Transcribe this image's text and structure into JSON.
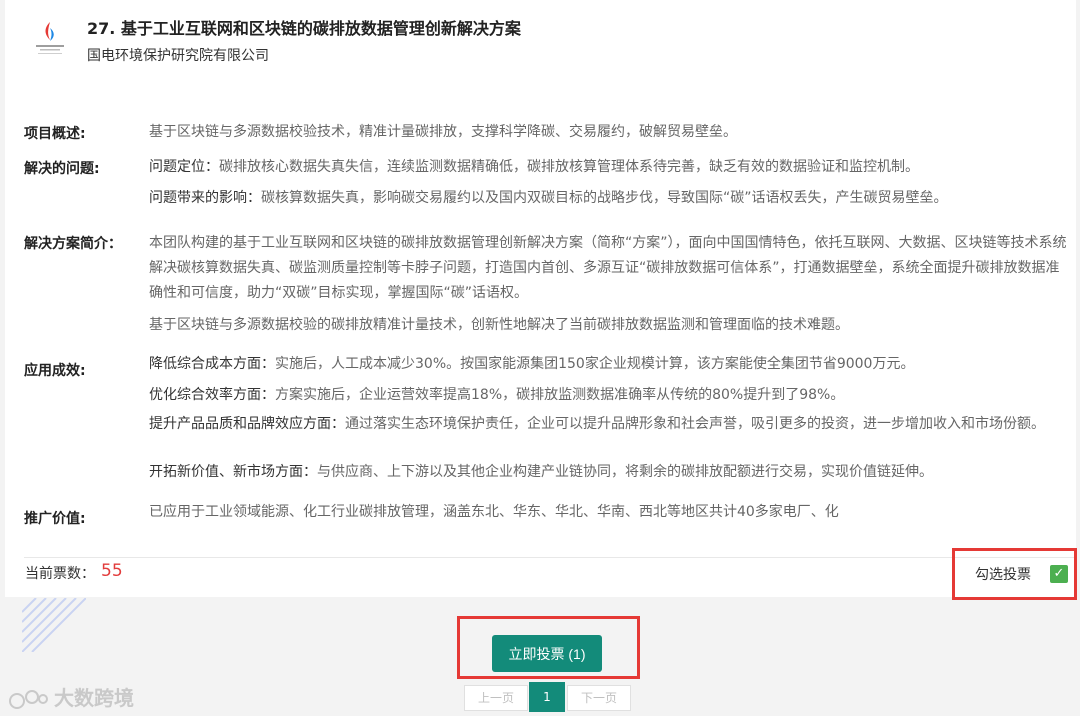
{
  "project": {
    "title": "27. 基于工业互联网和区块链的碳排放数据管理创新解决方案",
    "organization": "国电环境保护研究院有限公司"
  },
  "sections": {
    "overview": {
      "label": "项目概述:",
      "text": "基于区块链与多源数据校验技术，精准计量碳排放，支撑科学降碳、交易履约，破解贸易壁垒。"
    },
    "problems": {
      "label": "解决的问题:",
      "items": [
        {
          "key": "问题定位：",
          "text": "碳排放核心数据失真失信，连续监测数据精确低，碳排放核算管理体系待完善，缺乏有效的数据验证和监控机制。"
        },
        {
          "key": "问题带来的影响：",
          "text": "碳核算数据失真，影响碳交易履约以及国内双碳目标的战略步伐，导致国际“碳”话语权丢失，产生碳贸易壁垒。"
        }
      ]
    },
    "solution": {
      "label": "解决方案简介：",
      "paragraphs": [
        "本团队构建的基于工业互联网和区块链的碳排放数据管理创新解决方案（简称“方案”），面向中国国情特色，依托互联网、大数据、区块链等技术系统解决碳核算数据失真、碳监测质量控制等卡脖子问题，打造国内首创、多源互证“碳排放数据可信体系”，打通数据壁垒，系统全面提升碳排放数据准确性和可信度，助力“双碳”目标实现，掌握国际“碳”话语权。",
        "基于区块链与多源数据校验的碳排放精准计量技术，创新性地解决了当前碳排放数据监测和管理面临的技术难题。"
      ]
    },
    "effects": {
      "label": "应用成效:",
      "items": [
        {
          "key": "降低综合成本方面：",
          "text": "实施后，人工成本减少30%。按国家能源集团150家企业规模计算，该方案能使全集团节省9000万元。"
        },
        {
          "key": "优化综合效率方面：",
          "text": "方案实施后，企业运营效率提高18%，碳排放监测数据准确率从传统的80%提升到了98%。"
        },
        {
          "key": "提升产品品质和品牌效应方面：",
          "text": "通过落实生态环境保护责任，企业可以提升品牌形象和社会声誉，吸引更多的投资，进一步增加收入和市场份额。"
        },
        {
          "key": "开拓新价值、新市场方面：",
          "text": "与供应商、上下游以及其他企业构建产业链协同，将剩余的碳排放配额进行交易，实现价值链延伸。"
        }
      ]
    },
    "promotion": {
      "label": "推广价值:",
      "text": "已应用于工业领域能源、化工行业碳排放管理，涵盖东北、华东、华北、华南、西北等地区共计40多家电厂、化"
    }
  },
  "votes": {
    "label": "当前票数：",
    "count": "55",
    "select_label": "勾选投票",
    "checked": true
  },
  "vote_button": {
    "label": "立即投票 (1)"
  },
  "pagination": {
    "prev": "上一页",
    "current": "1",
    "next": "下一页"
  },
  "watermark": {
    "text": "大数跨境"
  },
  "colors": {
    "accent": "#138b7a",
    "highlight": "#e53935",
    "vote_count": "#e23c3c",
    "checkbox": "#4caf50"
  }
}
